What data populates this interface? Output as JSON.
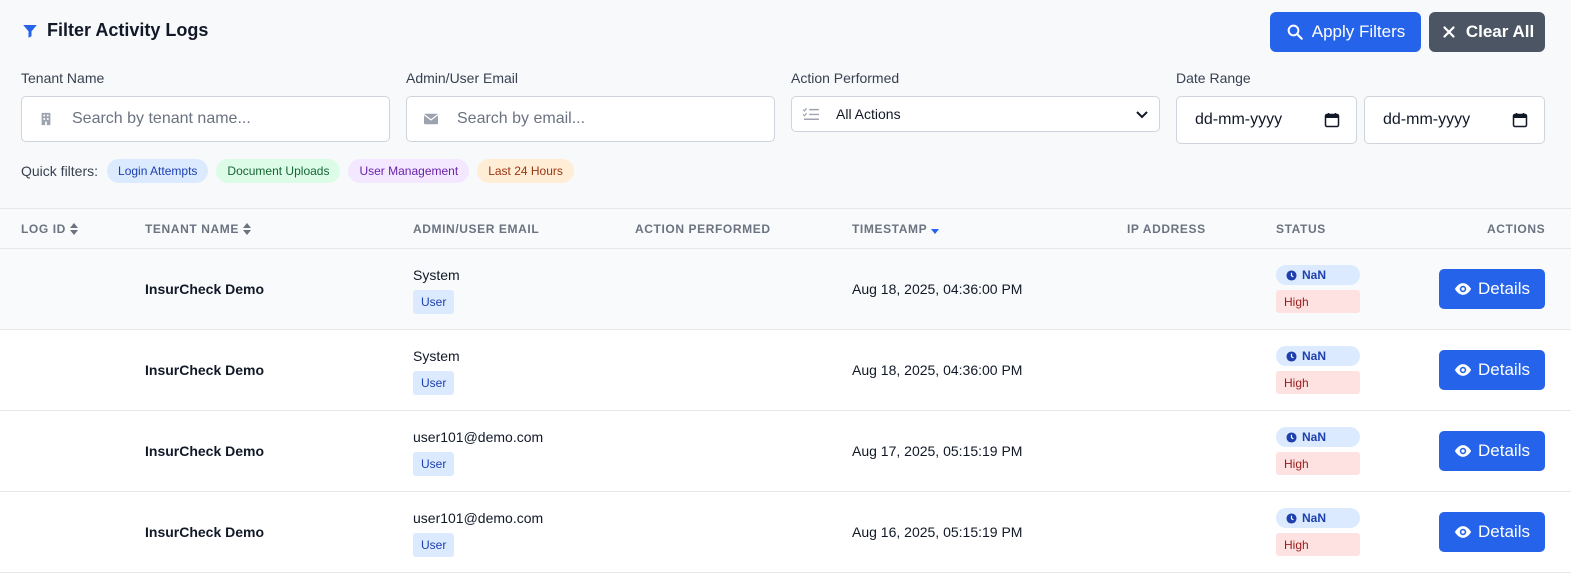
{
  "panel": {
    "title": "Filter Activity Logs",
    "apply_label": "Apply Filters",
    "clear_label": "Clear All"
  },
  "filters": {
    "tenant_label": "Tenant Name",
    "tenant_placeholder": "Search by tenant name...",
    "email_label": "Admin/User Email",
    "email_placeholder": "Search by email...",
    "action_label": "Action Performed",
    "action_value": "All Actions",
    "date_label": "Date Range",
    "date_from": "dd-mm-yyyy",
    "date_to": "dd-mm-yyyy"
  },
  "quick_filters": {
    "label": "Quick filters:",
    "chips": [
      "Login Attempts",
      "Document Uploads",
      "User Management",
      "Last 24 Hours"
    ]
  },
  "table": {
    "headers": [
      "LOG ID",
      "TENANT NAME",
      "ADMIN/USER EMAIL",
      "ACTION PERFORMED",
      "TIMESTAMP",
      "IP ADDRESS",
      "STATUS",
      "ACTIONS"
    ],
    "rows": [
      {
        "log_id": "",
        "tenant": "InsurCheck Demo",
        "email": "System",
        "role": "User",
        "action": "",
        "timestamp": "Aug 18, 2025, 04:36:00 PM",
        "ip": "",
        "status": "NaN",
        "severity": "High",
        "action_button": "Details"
      },
      {
        "log_id": "",
        "tenant": "InsurCheck Demo",
        "email": "System",
        "role": "User",
        "action": "",
        "timestamp": "Aug 18, 2025, 04:36:00 PM",
        "ip": "",
        "status": "NaN",
        "severity": "High",
        "action_button": "Details"
      },
      {
        "log_id": "",
        "tenant": "InsurCheck Demo",
        "email": "user101@demo.com",
        "role": "User",
        "action": "",
        "timestamp": "Aug 17, 2025, 05:15:19 PM",
        "ip": "",
        "status": "NaN",
        "severity": "High",
        "action_button": "Details"
      },
      {
        "log_id": "",
        "tenant": "InsurCheck Demo",
        "email": "user101@demo.com",
        "role": "User",
        "action": "",
        "timestamp": "Aug 16, 2025, 05:15:19 PM",
        "ip": "",
        "status": "NaN",
        "severity": "High",
        "action_button": "Details"
      }
    ]
  },
  "colors": {
    "primary": "#2563eb",
    "secondary": "#4b5563",
    "status_bg": "#dbeafe",
    "severity_bg": "#fee2e2"
  },
  "icons": {
    "title": "filter-icon",
    "apply": "search-icon",
    "clear": "close-icon",
    "tenant": "building-icon",
    "email": "envelope-icon",
    "action": "list-check-icon",
    "date": "calendar-icon",
    "sort": "sort-icon",
    "sort_desc": "caret-down-icon",
    "status": "clock-icon",
    "details": "eye-icon"
  }
}
